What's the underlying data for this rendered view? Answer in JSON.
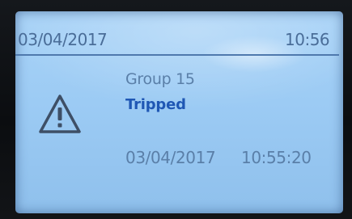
{
  "header": {
    "date": "03/04/2017",
    "time": "10:56"
  },
  "alarm": {
    "icon": "warning-triangle-icon",
    "group": "Group 15",
    "status": "Tripped",
    "event_date": "03/04/2017",
    "event_time": "10:55:20"
  },
  "colors": {
    "screen": "#9ccbf4",
    "text": "#4a6d98",
    "status": "#1f57b4"
  }
}
